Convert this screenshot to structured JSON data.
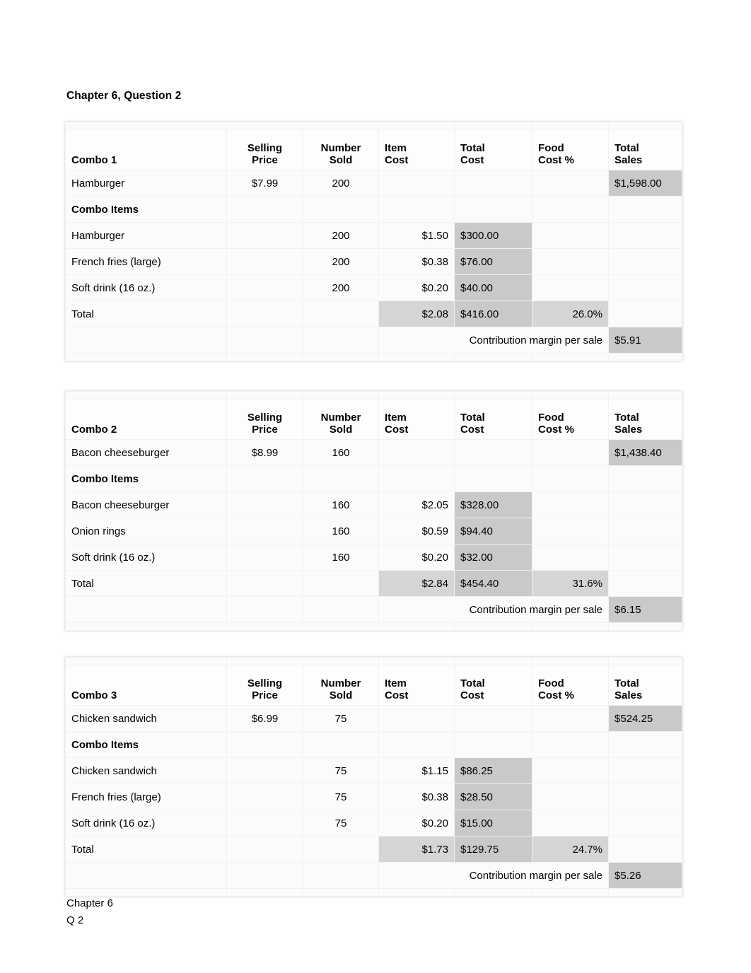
{
  "document": {
    "title": "Chapter 6, Question 2",
    "footer": [
      "Chapter 6",
      "Q 2"
    ]
  },
  "columns": {
    "name": "",
    "selling_price": "Selling\nPrice",
    "selling_price_l1": "Selling",
    "selling_price_l2": "Price",
    "number_sold_l1": "Number",
    "number_sold_l2": "Sold",
    "item_cost_l1": "Item",
    "item_cost_l2": "Cost",
    "total_cost_l1": "Total",
    "total_cost_l2": "Cost",
    "food_cost_pct_l1": "Food",
    "food_cost_pct_l2": "Cost %",
    "total_sales_l1": "Total",
    "total_sales_l2": "Sales"
  },
  "labels": {
    "combo_items": "Combo Items",
    "total": "Total",
    "contribution_margin": "Contribution margin per sale"
  },
  "tables": [
    {
      "header_label": "Combo 1",
      "main_item": {
        "name": "Hamburger",
        "selling_price": "$7.99",
        "number_sold": "200",
        "total_sales": "$1,598.00"
      },
      "items": [
        {
          "name": "Hamburger",
          "number_sold": "200",
          "item_cost": "$1.50",
          "total_cost": "$300.00"
        },
        {
          "name": "French fries (large)",
          "number_sold": "200",
          "item_cost": "$0.38",
          "total_cost": "$76.00"
        },
        {
          "name": "Soft drink (16 oz.)",
          "number_sold": "200",
          "item_cost": "$0.20",
          "total_cost": "$40.00"
        }
      ],
      "total": {
        "item_cost": "$2.08",
        "total_cost": "$416.00",
        "food_cost_pct": "26.0%"
      },
      "contribution_margin": "$5.91"
    },
    {
      "header_label": "Combo 2",
      "main_item": {
        "name": "Bacon cheeseburger",
        "selling_price": "$8.99",
        "number_sold": "160",
        "total_sales": "$1,438.40"
      },
      "items": [
        {
          "name": "Bacon cheeseburger",
          "number_sold": "160",
          "item_cost": "$2.05",
          "total_cost": "$328.00"
        },
        {
          "name": "Onion rings",
          "number_sold": "160",
          "item_cost": "$0.59",
          "total_cost": "$94.40"
        },
        {
          "name": "Soft drink (16 oz.)",
          "number_sold": "160",
          "item_cost": "$0.20",
          "total_cost": "$32.00"
        }
      ],
      "total": {
        "item_cost": "$2.84",
        "total_cost": "$454.40",
        "food_cost_pct": "31.6%"
      },
      "contribution_margin": "$6.15"
    },
    {
      "header_label": "Combo 3",
      "main_item": {
        "name": "Chicken sandwich",
        "selling_price": "$6.99",
        "number_sold": "75",
        "total_sales": "$524.25"
      },
      "items": [
        {
          "name": "Chicken sandwich",
          "number_sold": "75",
          "item_cost": "$1.15",
          "total_cost": "$86.25"
        },
        {
          "name": "French fries (large)",
          "number_sold": "75",
          "item_cost": "$0.38",
          "total_cost": "$28.50"
        },
        {
          "name": "Soft drink (16 oz.)",
          "number_sold": "75",
          "item_cost": "$0.20",
          "total_cost": "$15.00"
        }
      ],
      "total": {
        "item_cost": "$1.73",
        "total_cost": "$129.75",
        "food_cost_pct": "24.7%"
      },
      "contribution_margin": "$5.26"
    }
  ]
}
